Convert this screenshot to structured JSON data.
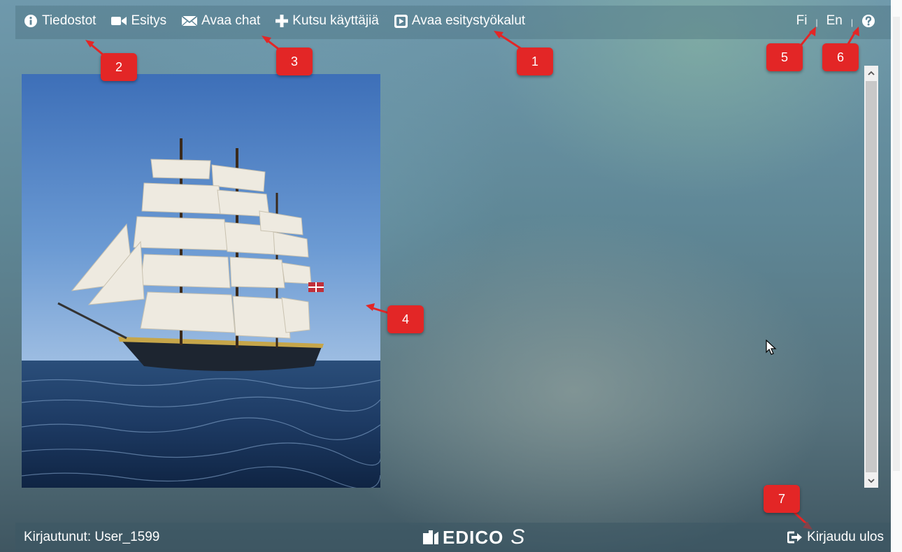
{
  "nav": {
    "files_label": "Tiedostot",
    "presentation_label": "Esitys",
    "open_chat_label": "Avaa chat",
    "invite_users_label": "Kutsu käyttäjiä",
    "open_tools_label": "Avaa esitystyökalut"
  },
  "language": {
    "fi_label": "Fi",
    "separator": "|",
    "en_label": "En"
  },
  "annotations": {
    "badge_1": "1",
    "badge_2": "2",
    "badge_3": "3",
    "badge_4": "4",
    "badge_5": "5",
    "badge_6": "6",
    "badge_7": "7"
  },
  "footer": {
    "logged_in_text": "Kirjautunut: User_1599",
    "logo_text": "EDICO",
    "logo_suffix": "S",
    "logout_label": "Kirjaudu ulos"
  },
  "icons": {
    "files": "info-circle-icon",
    "presentation": "video-camera-icon",
    "chat": "envelope-icon",
    "invite": "plus-icon",
    "tools": "play-square-icon",
    "help": "question-circle-icon",
    "logout": "sign-out-icon"
  },
  "colors": {
    "badge": "#e32626",
    "text": "#ffffff"
  }
}
